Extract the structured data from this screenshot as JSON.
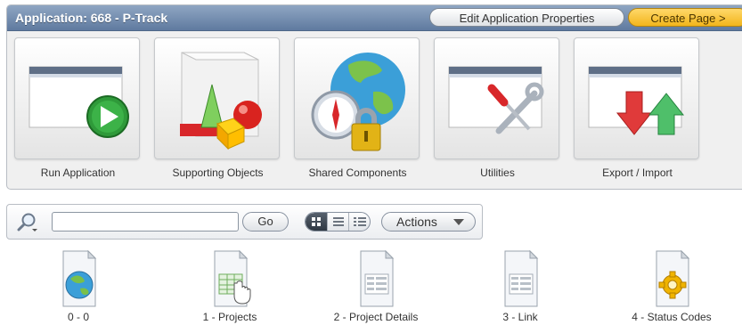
{
  "header": {
    "title": "Application: 668 - P-Track",
    "edit_button": "Edit Application Properties",
    "create_button": "Create Page >"
  },
  "tiles": [
    {
      "label": "Run Application",
      "icon": "run-application-icon"
    },
    {
      "label": "Supporting Objects",
      "icon": "supporting-objects-icon"
    },
    {
      "label": "Shared Components",
      "icon": "shared-components-icon"
    },
    {
      "label": "Utilities",
      "icon": "utilities-icon"
    },
    {
      "label": "Export / Import",
      "icon": "export-import-icon"
    }
  ],
  "toolbar": {
    "search_value": "",
    "go_label": "Go",
    "actions_label": "Actions",
    "views": [
      "icon-view",
      "report-view",
      "detail-view"
    ],
    "active_view": "icon-view"
  },
  "pages": [
    {
      "label": "0 - 0",
      "icon": "globe-page-icon"
    },
    {
      "label": "1 - Projects",
      "icon": "table-hand-page-icon"
    },
    {
      "label": "2 - Project Details",
      "icon": "form-page-icon"
    },
    {
      "label": "3 - Link",
      "icon": "form-page-icon"
    },
    {
      "label": "4 - Status Codes",
      "icon": "gear-page-icon"
    }
  ],
  "colors": {
    "header_bg": "#6f88ab",
    "create_button_bg": "#f6c232",
    "run_green": "#2f9a3a"
  }
}
